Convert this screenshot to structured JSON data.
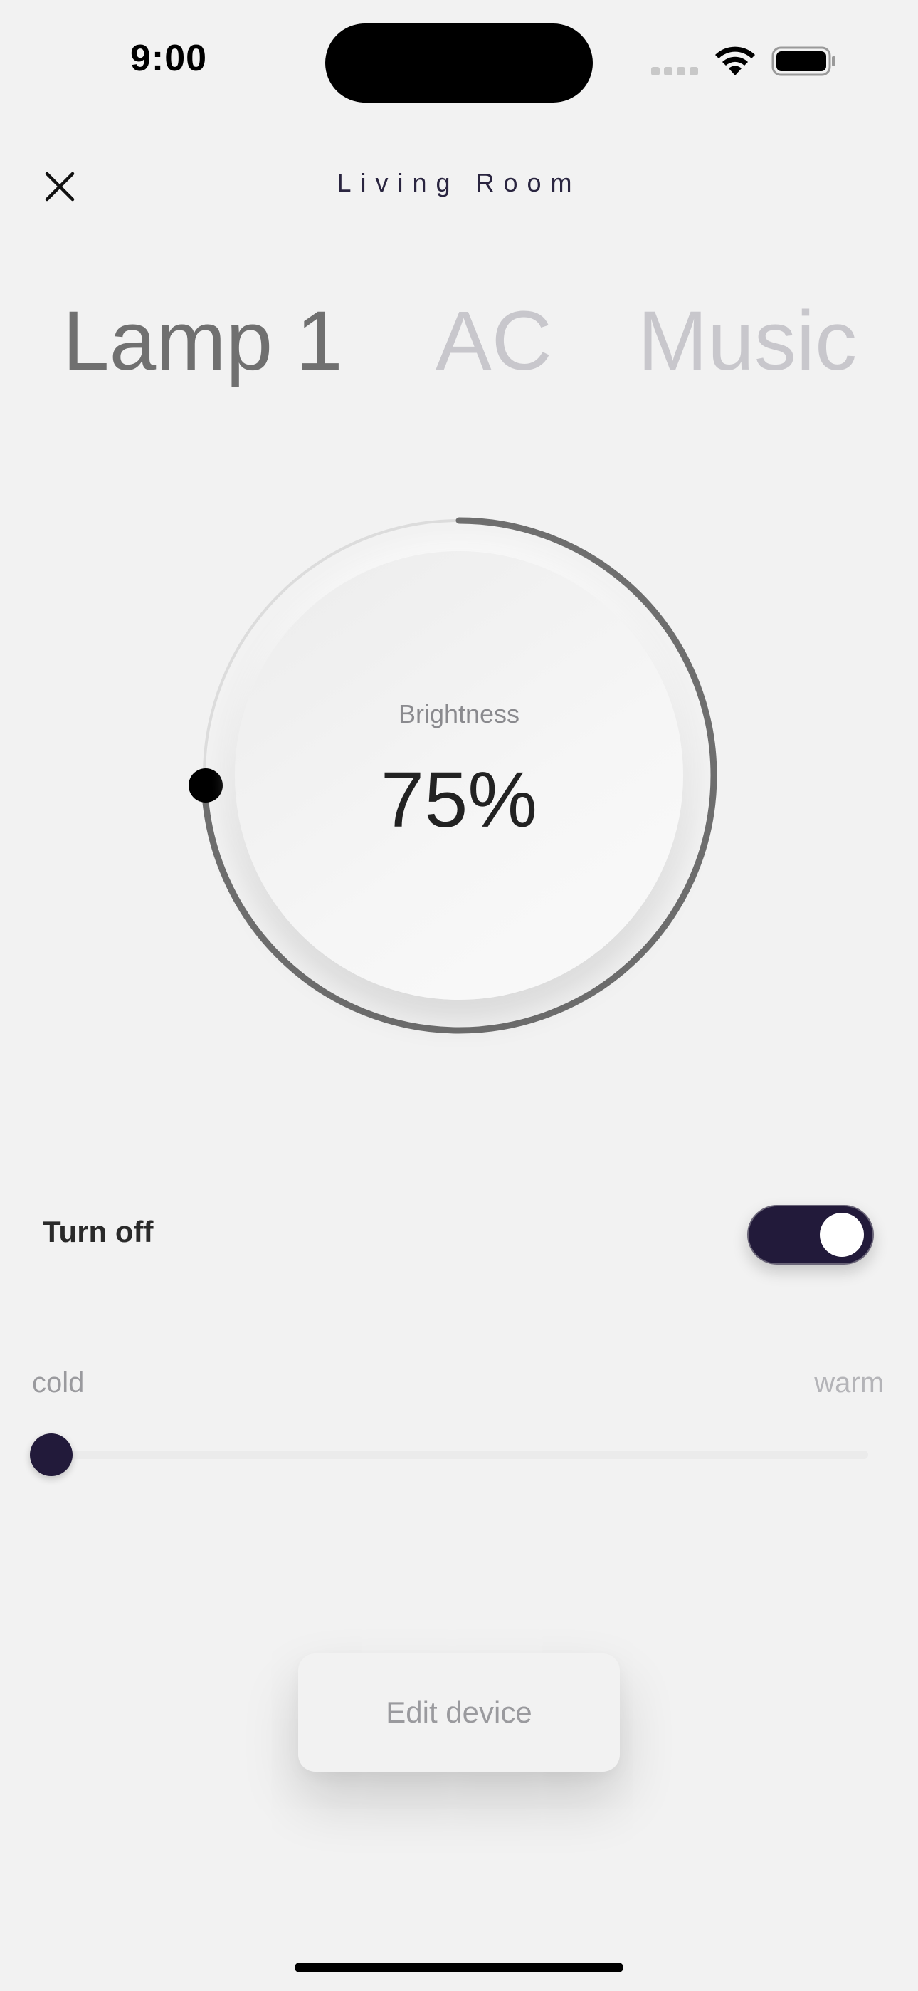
{
  "status_bar": {
    "time": "9:00"
  },
  "header": {
    "title": "Living Room",
    "close_icon": "close-icon"
  },
  "tabs": [
    {
      "label": "Lamp 1",
      "active": true
    },
    {
      "label": "AC",
      "active": false
    },
    {
      "label": "Music",
      "active": false
    }
  ],
  "dial": {
    "label": "Brightness",
    "value_text": "75%",
    "value": 75
  },
  "power": {
    "label": "Turn off",
    "on": true
  },
  "temperature": {
    "min_label": "cold",
    "max_label": "warm",
    "value": 0
  },
  "actions": {
    "edit_label": "Edit device"
  },
  "colors": {
    "background": "#f2f2f2",
    "accent": "#221a3a",
    "dial_arc": "#6e6e6e",
    "inactive_tab": "#c8c7cc"
  }
}
